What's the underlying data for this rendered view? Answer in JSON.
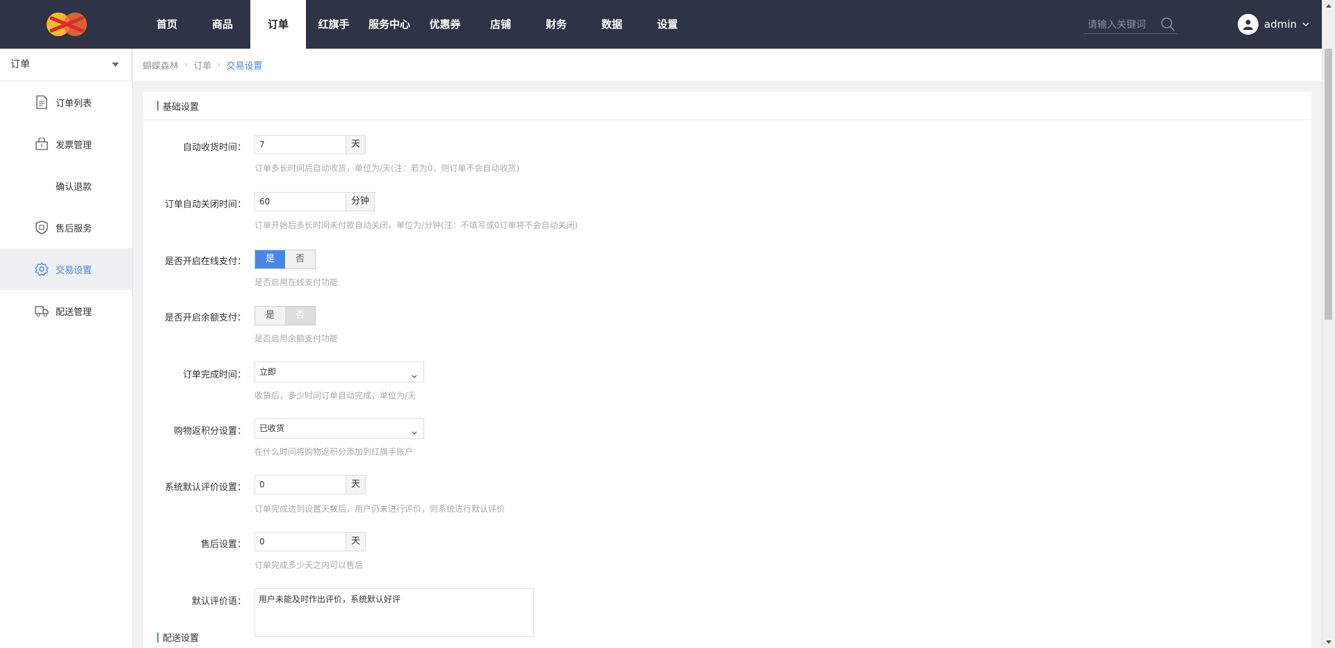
{
  "header": {
    "nav": [
      "首页",
      "商品",
      "订单",
      "红旗手",
      "服务中心",
      "优惠券",
      "店铺",
      "财务",
      "数据",
      "设置"
    ],
    "active_nav": "订单",
    "search_placeholder": "请输入关键词",
    "username": "admin"
  },
  "sidebar": {
    "select_label": "订单",
    "items": [
      {
        "label": "订单列表",
        "icon": "document-icon"
      },
      {
        "label": "发票管理",
        "icon": "invoice-icon"
      },
      {
        "label": "确认退款",
        "icon": ""
      },
      {
        "label": "售后服务",
        "icon": "shield-icon"
      },
      {
        "label": "交易设置",
        "icon": "gear-icon",
        "active": true
      },
      {
        "label": "配送管理",
        "icon": "delivery-icon"
      }
    ]
  },
  "breadcrumb": [
    "蝴蝶森林",
    "订单",
    "交易设置"
  ],
  "section": {
    "title": "基础设置",
    "next_title": "配送设置"
  },
  "form": {
    "auto_receive": {
      "label": "自动收货时间：",
      "value": "7",
      "unit": "天",
      "hint": "订单多长时间后自动收货，单位为/天(注：若为0，则订单不会自动收货)"
    },
    "auto_close": {
      "label": "订单自动关闭时间：",
      "value": "60",
      "unit": "分钟",
      "hint": "订单开始后多长时间未付款自动关闭，单位为/分钟(注：不填写或0订单将不会自动关闭)"
    },
    "online_pay": {
      "label": "是否开启在线支付：",
      "yes": "是",
      "no": "否",
      "selected": "是",
      "hint": "是否启用在线支付功能"
    },
    "balance_pay": {
      "label": "是否开启余额支付：",
      "yes": "是",
      "no": "否",
      "selected": "否",
      "hint": "是否启用余额支付功能"
    },
    "complete_time": {
      "label": "订单完成时间：",
      "value": "立即",
      "hint": "收货后，多少时间订单自动完成，单位为/天"
    },
    "points_return": {
      "label": "购物返积分设置：",
      "value": "已收货",
      "hint": "在什么时间将购物返积分添加到红旗手账户"
    },
    "default_review": {
      "label": "系统默认评价设置：",
      "value": "0",
      "unit": "天",
      "hint": "订单完成达到设置天数后，用户仍未进行评价，则系统进行默认评价"
    },
    "after_sale": {
      "label": "售后设置：",
      "value": "0",
      "unit": "天",
      "hint": "订单完成多少天之内可以售后"
    },
    "review_text": {
      "label": "默认评价语：",
      "value": "用户未能及时作出评价，系统默认好评"
    }
  },
  "colors": {
    "topbar": "#2e3446",
    "accent": "#4a86e8"
  }
}
